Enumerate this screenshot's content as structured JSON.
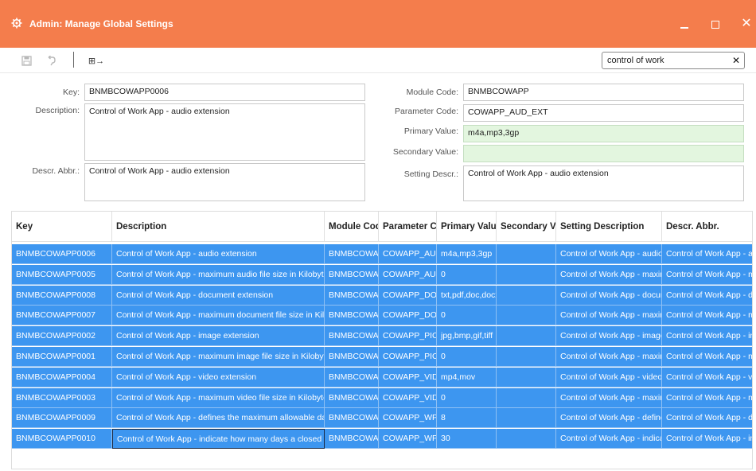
{
  "window": {
    "title": "Admin: Manage Global Settings",
    "accent_color": "#f47d4c",
    "icons": [
      "gear-icon",
      "minimize-icon",
      "maximize-icon",
      "close-icon"
    ]
  },
  "toolbar": {
    "icons": [
      "save-icon",
      "undo-icon",
      "export-icon"
    ],
    "export_glyph": "⊞→"
  },
  "search": {
    "value": "control of work",
    "clear_glyph": "✕"
  },
  "form": {
    "key_label": "Key:",
    "key_value": "BNMBCOWAPP0006",
    "description_label": "Description:",
    "description_value": "Control of Work App - audio extension",
    "descr_abbr_label": "Descr. Abbr.:",
    "descr_abbr_value": "Control of Work App - audio extension",
    "module_code_label": "Module Code:",
    "module_code_value": "BNMBCOWAPP",
    "parameter_code_label": "Parameter Code:",
    "parameter_code_value": "COWAPP_AUD_EXT",
    "primary_value_label": "Primary Value:",
    "primary_value_value": "m4a,mp3,3gp",
    "secondary_value_label": "Secondary Value:",
    "secondary_value_value": "",
    "setting_descr_label": "Setting Descr.:",
    "setting_descr_value": "Control of Work App - audio extension"
  },
  "grid": {
    "selection_color": "#3d96f0",
    "columns": [
      "Key",
      "Description",
      "Module Code",
      "Parameter Code",
      "Primary Value",
      "Secondary Value",
      "Setting Description",
      "Descr. Abbr."
    ],
    "rows": [
      [
        "BNMBCOWAPP0006",
        "Control of Work App - audio extension",
        "BNMBCOWAPP",
        "COWAPP_AUD_EXT",
        "m4a,mp3,3gp",
        "",
        "Control of Work App - audio extension",
        "Control of Work App - audio extension"
      ],
      [
        "BNMBCOWAPP0005",
        "Control of Work App - maximum audio file size in Kilobytes",
        "BNMBCOWAPP",
        "COWAPP_AUD_SIZE",
        "0",
        "",
        "Control of Work App - maximum audio file size in Kilobytes",
        "Control of Work App - maximum audio file size in Kilobytes"
      ],
      [
        "BNMBCOWAPP0008",
        "Control of Work App - document extension",
        "BNMBCOWAPP",
        "COWAPP_DOC_EXT",
        "txt,pdf,doc,docx",
        "",
        "Control of Work App - document extension",
        "Control of Work App - document extension"
      ],
      [
        "BNMBCOWAPP0007",
        "Control of Work App - maximum document file size in Kilobytes",
        "BNMBCOWAPP",
        "COWAPP_DOC_SIZE",
        "0",
        "",
        "Control of Work App - maximum document file size in Kilobytes",
        "Control of Work App - maximum document file size in Kilobytes"
      ],
      [
        "BNMBCOWAPP0002",
        "Control of Work App - image extension",
        "BNMBCOWAPP",
        "COWAPP_PIC_EXT",
        "jpg,bmp,gif,tiff",
        "",
        "Control of Work App - image extension",
        "Control of Work App - image extension"
      ],
      [
        "BNMBCOWAPP0001",
        "Control of Work App - maximum image file size in Kilobytes",
        "BNMBCOWAPP",
        "COWAPP_PIC_SIZE",
        "0",
        "",
        "Control of Work App - maximum image file size in Kilobytes",
        "Control of Work App - maximum image file size in Kilobytes"
      ],
      [
        "BNMBCOWAPP0004",
        "Control of Work App - video extension",
        "BNMBCOWAPP",
        "COWAPP_VID_EXT",
        "mp4,mov",
        "",
        "Control of Work App - video extension",
        "Control of Work App - video extension"
      ],
      [
        "BNMBCOWAPP0003",
        "Control of Work App - maximum video file size in Kilobytes",
        "BNMBCOWAPP",
        "COWAPP_VID_SIZE",
        "0",
        "",
        "Control of Work App - maximum video file size in Kilobytes",
        "Control of Work App - maximum video file size in Kilobytes"
      ],
      [
        "BNMBCOWAPP0009",
        "Control of Work App - defines the maximum allowable days",
        "BNMBCOWAPP",
        "COWAPP_WP_DAYS",
        "8",
        "",
        "Control of Work App - defines the maximum allowable days",
        "Control of Work App - defines the maximum allowable days"
      ],
      [
        "BNMBCOWAPP0010",
        "Control of Work App - indicate how many days a closed permit",
        "BNMBCOWAPP",
        "COWAPP_WP_CLOSED",
        "30",
        "",
        "Control of Work App - indicate how many days a closed permit",
        "Control of Work App - indicate how many days a closed permit"
      ]
    ]
  }
}
